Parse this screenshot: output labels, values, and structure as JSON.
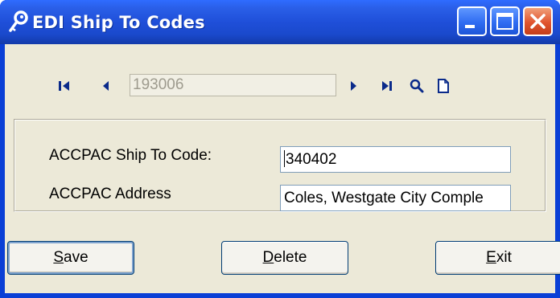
{
  "window": {
    "title": "EDI Ship To Codes"
  },
  "navigation": {
    "record_value": "193006"
  },
  "form": {
    "ship_to_label": "ACCPAC Ship To Code:",
    "ship_to_value": "340402",
    "address_label": "ACCPAC Address",
    "address_value": "Coles, Westgate City Comple"
  },
  "buttons": {
    "save_mnemonic": "S",
    "save_rest": "ave",
    "delete_mnemonic": "D",
    "delete_rest": "elete",
    "exit_mnemonic": "E",
    "exit_rest": "xit"
  },
  "colors": {
    "titlebar": "#1f4fd9",
    "client_background": "#ece9d8",
    "nav_icons": "#0a2a8a",
    "close_button": "#e1542f"
  }
}
